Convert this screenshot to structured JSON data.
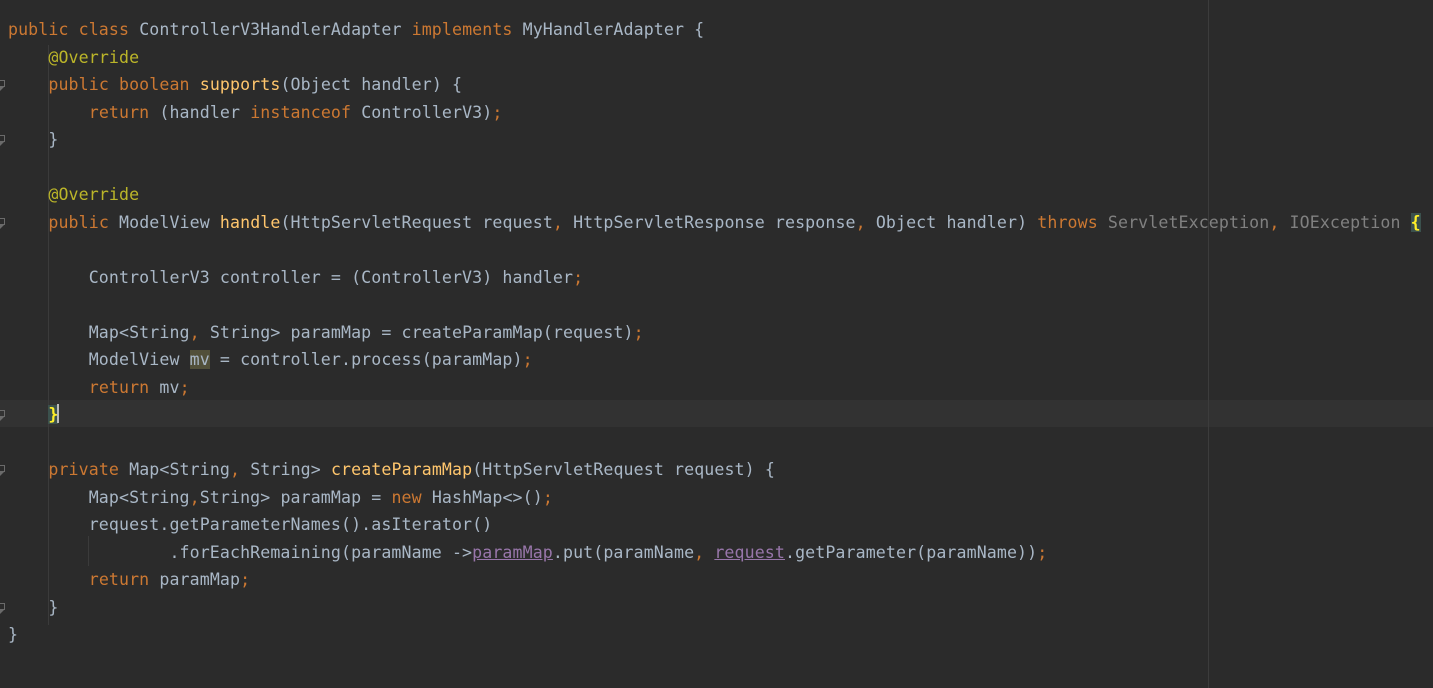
{
  "editor": {
    "lines": [
      [
        {
          "t": "public class ",
          "c": "kw"
        },
        {
          "t": "ControllerV3HandlerAdapter ",
          "c": ""
        },
        {
          "t": "implements ",
          "c": "kw"
        },
        {
          "t": "MyHandlerAdapter {",
          "c": ""
        }
      ],
      [
        {
          "t": "    ",
          "c": ""
        },
        {
          "t": "@Override",
          "c": "ann"
        }
      ],
      [
        {
          "t": "    ",
          "c": ""
        },
        {
          "t": "public boolean ",
          "c": "kw"
        },
        {
          "t": "supports",
          "c": "fn"
        },
        {
          "t": "(Object handler) {",
          "c": ""
        }
      ],
      [
        {
          "t": "        ",
          "c": ""
        },
        {
          "t": "return ",
          "c": "kw"
        },
        {
          "t": "(handler ",
          "c": ""
        },
        {
          "t": "instanceof ",
          "c": "kw"
        },
        {
          "t": "ControllerV3)",
          "c": ""
        },
        {
          "t": ";",
          "c": "kw"
        }
      ],
      [
        {
          "t": "    }",
          "c": ""
        }
      ],
      [],
      [
        {
          "t": "    ",
          "c": ""
        },
        {
          "t": "@Override",
          "c": "ann"
        }
      ],
      [
        {
          "t": "    ",
          "c": ""
        },
        {
          "t": "public ",
          "c": "kw"
        },
        {
          "t": "ModelView ",
          "c": ""
        },
        {
          "t": "handle",
          "c": "fn"
        },
        {
          "t": "(HttpServletRequest request",
          "c": ""
        },
        {
          "t": ", ",
          "c": "kw"
        },
        {
          "t": "HttpServletResponse response",
          "c": ""
        },
        {
          "t": ", ",
          "c": "kw"
        },
        {
          "t": "Object handler) ",
          "c": ""
        },
        {
          "t": "throws ",
          "c": "kw"
        },
        {
          "t": "ServletException",
          "c": "gr"
        },
        {
          "t": ", ",
          "c": "kw"
        },
        {
          "t": "IOException",
          "c": "gr"
        },
        {
          "t": " ",
          "c": ""
        },
        {
          "t": "{",
          "c": "brace-hl"
        }
      ],
      [],
      [
        {
          "t": "        ControllerV3 controller = (ControllerV3) handler",
          "c": ""
        },
        {
          "t": ";",
          "c": "kw"
        }
      ],
      [],
      [
        {
          "t": "        Map<String",
          "c": ""
        },
        {
          "t": ", ",
          "c": "kw"
        },
        {
          "t": "String> paramMap = createParamMap(request)",
          "c": ""
        },
        {
          "t": ";",
          "c": "kw"
        }
      ],
      [
        {
          "t": "        ModelView ",
          "c": ""
        },
        {
          "t": "mv",
          "c": "hl"
        },
        {
          "t": " = controller.process(paramMap)",
          "c": ""
        },
        {
          "t": ";",
          "c": "kw"
        }
      ],
      [
        {
          "t": "        ",
          "c": ""
        },
        {
          "t": "return ",
          "c": "kw"
        },
        {
          "t": "mv",
          "c": ""
        },
        {
          "t": ";",
          "c": "kw"
        }
      ],
      [
        {
          "t": "    ",
          "c": ""
        },
        {
          "t": "}",
          "c": "brace-hl"
        }
      ],
      [],
      [
        {
          "t": "    ",
          "c": ""
        },
        {
          "t": "private ",
          "c": "kw"
        },
        {
          "t": "Map<String",
          "c": ""
        },
        {
          "t": ", ",
          "c": "kw"
        },
        {
          "t": "String> ",
          "c": ""
        },
        {
          "t": "createParamMap",
          "c": "fn"
        },
        {
          "t": "(HttpServletRequest request) {",
          "c": ""
        }
      ],
      [
        {
          "t": "        Map<String",
          "c": ""
        },
        {
          "t": ",",
          "c": "kw"
        },
        {
          "t": "String> paramMap = ",
          "c": ""
        },
        {
          "t": "new ",
          "c": "kw"
        },
        {
          "t": "HashMap<>()",
          "c": ""
        },
        {
          "t": ";",
          "c": "kw"
        }
      ],
      [
        {
          "t": "        request.getParameterNames().asIterator()",
          "c": ""
        }
      ],
      [
        {
          "t": "                .forEachRemaining(paramName ->",
          "c": ""
        },
        {
          "t": "paramMap",
          "c": "lam"
        },
        {
          "t": ".put(paramName",
          "c": ""
        },
        {
          "t": ", ",
          "c": "kw"
        },
        {
          "t": "request",
          "c": "lam"
        },
        {
          "t": ".getParameter(paramName))",
          "c": ""
        },
        {
          "t": ";",
          "c": "kw"
        }
      ],
      [
        {
          "t": "        ",
          "c": ""
        },
        {
          "t": "return ",
          "c": "kw"
        },
        {
          "t": "paramMap",
          "c": ""
        },
        {
          "t": ";",
          "c": "kw"
        }
      ],
      [
        {
          "t": "    }",
          "c": ""
        }
      ],
      [
        {
          "t": "}",
          "c": ""
        }
      ]
    ]
  }
}
